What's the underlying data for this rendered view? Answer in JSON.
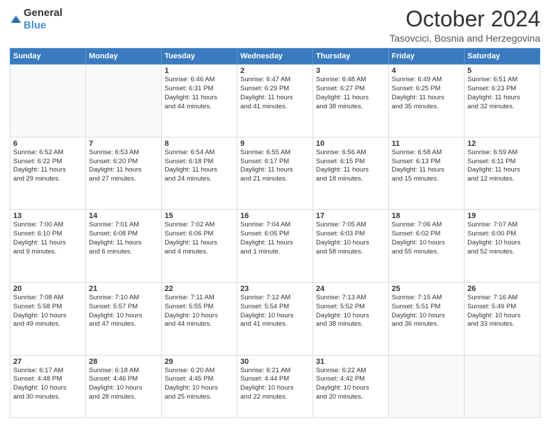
{
  "header": {
    "logo_general": "General",
    "logo_blue": "Blue",
    "month": "October 2024",
    "location": "Tasovcici, Bosnia and Herzegovina"
  },
  "weekdays": [
    "Sunday",
    "Monday",
    "Tuesday",
    "Wednesday",
    "Thursday",
    "Friday",
    "Saturday"
  ],
  "weeks": [
    [
      {
        "day": "",
        "lines": [],
        "empty": true
      },
      {
        "day": "",
        "lines": [],
        "empty": true
      },
      {
        "day": "1",
        "lines": [
          "Sunrise: 6:46 AM",
          "Sunset: 6:31 PM",
          "Daylight: 11 hours",
          "and 44 minutes."
        ]
      },
      {
        "day": "2",
        "lines": [
          "Sunrise: 6:47 AM",
          "Sunset: 6:29 PM",
          "Daylight: 11 hours",
          "and 41 minutes."
        ]
      },
      {
        "day": "3",
        "lines": [
          "Sunrise: 6:48 AM",
          "Sunset: 6:27 PM",
          "Daylight: 11 hours",
          "and 38 minutes."
        ]
      },
      {
        "day": "4",
        "lines": [
          "Sunrise: 6:49 AM",
          "Sunset: 6:25 PM",
          "Daylight: 11 hours",
          "and 35 minutes."
        ]
      },
      {
        "day": "5",
        "lines": [
          "Sunrise: 6:51 AM",
          "Sunset: 6:23 PM",
          "Daylight: 11 hours",
          "and 32 minutes."
        ]
      }
    ],
    [
      {
        "day": "6",
        "lines": [
          "Sunrise: 6:52 AM",
          "Sunset: 6:22 PM",
          "Daylight: 11 hours",
          "and 29 minutes."
        ]
      },
      {
        "day": "7",
        "lines": [
          "Sunrise: 6:53 AM",
          "Sunset: 6:20 PM",
          "Daylight: 11 hours",
          "and 27 minutes."
        ]
      },
      {
        "day": "8",
        "lines": [
          "Sunrise: 6:54 AM",
          "Sunset: 6:18 PM",
          "Daylight: 11 hours",
          "and 24 minutes."
        ]
      },
      {
        "day": "9",
        "lines": [
          "Sunrise: 6:55 AM",
          "Sunset: 6:17 PM",
          "Daylight: 11 hours",
          "and 21 minutes."
        ]
      },
      {
        "day": "10",
        "lines": [
          "Sunrise: 6:56 AM",
          "Sunset: 6:15 PM",
          "Daylight: 11 hours",
          "and 18 minutes."
        ]
      },
      {
        "day": "11",
        "lines": [
          "Sunrise: 6:58 AM",
          "Sunset: 6:13 PM",
          "Daylight: 11 hours",
          "and 15 minutes."
        ]
      },
      {
        "day": "12",
        "lines": [
          "Sunrise: 6:59 AM",
          "Sunset: 6:11 PM",
          "Daylight: 11 hours",
          "and 12 minutes."
        ]
      }
    ],
    [
      {
        "day": "13",
        "lines": [
          "Sunrise: 7:00 AM",
          "Sunset: 6:10 PM",
          "Daylight: 11 hours",
          "and 9 minutes."
        ]
      },
      {
        "day": "14",
        "lines": [
          "Sunrise: 7:01 AM",
          "Sunset: 6:08 PM",
          "Daylight: 11 hours",
          "and 6 minutes."
        ]
      },
      {
        "day": "15",
        "lines": [
          "Sunrise: 7:02 AM",
          "Sunset: 6:06 PM",
          "Daylight: 11 hours",
          "and 4 minutes."
        ]
      },
      {
        "day": "16",
        "lines": [
          "Sunrise: 7:04 AM",
          "Sunset: 6:05 PM",
          "Daylight: 11 hours",
          "and 1 minute."
        ]
      },
      {
        "day": "17",
        "lines": [
          "Sunrise: 7:05 AM",
          "Sunset: 6:03 PM",
          "Daylight: 10 hours",
          "and 58 minutes."
        ]
      },
      {
        "day": "18",
        "lines": [
          "Sunrise: 7:06 AM",
          "Sunset: 6:02 PM",
          "Daylight: 10 hours",
          "and 55 minutes."
        ]
      },
      {
        "day": "19",
        "lines": [
          "Sunrise: 7:07 AM",
          "Sunset: 6:00 PM",
          "Daylight: 10 hours",
          "and 52 minutes."
        ]
      }
    ],
    [
      {
        "day": "20",
        "lines": [
          "Sunrise: 7:08 AM",
          "Sunset: 5:58 PM",
          "Daylight: 10 hours",
          "and 49 minutes."
        ]
      },
      {
        "day": "21",
        "lines": [
          "Sunrise: 7:10 AM",
          "Sunset: 5:57 PM",
          "Daylight: 10 hours",
          "and 47 minutes."
        ]
      },
      {
        "day": "22",
        "lines": [
          "Sunrise: 7:11 AM",
          "Sunset: 5:55 PM",
          "Daylight: 10 hours",
          "and 44 minutes."
        ]
      },
      {
        "day": "23",
        "lines": [
          "Sunrise: 7:12 AM",
          "Sunset: 5:54 PM",
          "Daylight: 10 hours",
          "and 41 minutes."
        ]
      },
      {
        "day": "24",
        "lines": [
          "Sunrise: 7:13 AM",
          "Sunset: 5:52 PM",
          "Daylight: 10 hours",
          "and 38 minutes."
        ]
      },
      {
        "day": "25",
        "lines": [
          "Sunrise: 7:15 AM",
          "Sunset: 5:51 PM",
          "Daylight: 10 hours",
          "and 36 minutes."
        ]
      },
      {
        "day": "26",
        "lines": [
          "Sunrise: 7:16 AM",
          "Sunset: 5:49 PM",
          "Daylight: 10 hours",
          "and 33 minutes."
        ]
      }
    ],
    [
      {
        "day": "27",
        "lines": [
          "Sunrise: 6:17 AM",
          "Sunset: 4:48 PM",
          "Daylight: 10 hours",
          "and 30 minutes."
        ]
      },
      {
        "day": "28",
        "lines": [
          "Sunrise: 6:18 AM",
          "Sunset: 4:46 PM",
          "Daylight: 10 hours",
          "and 28 minutes."
        ]
      },
      {
        "day": "29",
        "lines": [
          "Sunrise: 6:20 AM",
          "Sunset: 4:45 PM",
          "Daylight: 10 hours",
          "and 25 minutes."
        ]
      },
      {
        "day": "30",
        "lines": [
          "Sunrise: 6:21 AM",
          "Sunset: 4:44 PM",
          "Daylight: 10 hours",
          "and 22 minutes."
        ]
      },
      {
        "day": "31",
        "lines": [
          "Sunrise: 6:22 AM",
          "Sunset: 4:42 PM",
          "Daylight: 10 hours",
          "and 20 minutes."
        ]
      },
      {
        "day": "",
        "lines": [],
        "empty": true
      },
      {
        "day": "",
        "lines": [],
        "empty": true
      }
    ]
  ]
}
